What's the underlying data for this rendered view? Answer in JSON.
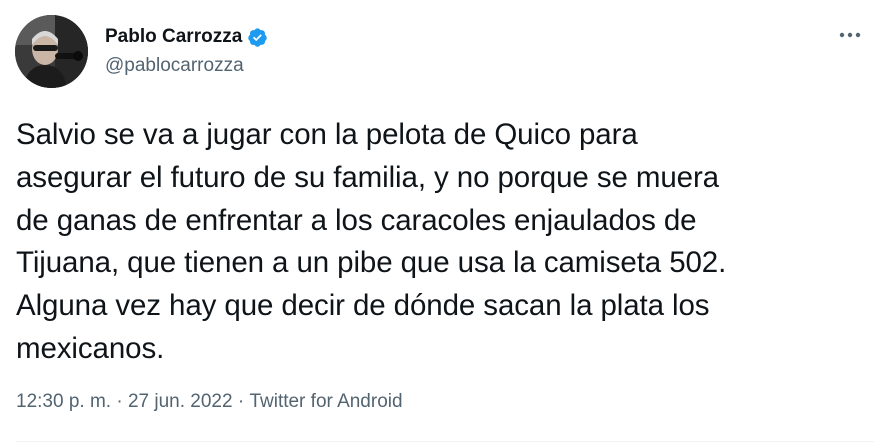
{
  "author": {
    "display_name": "Pablo Carrozza",
    "handle": "@pablocarrozza",
    "verified": true,
    "verified_color": "#1d9bf0"
  },
  "tweet": {
    "text": "Salvio se va a jugar con la pelota de Quico para\nasegurar el futuro de su familia, y no porque se muera\nde ganas de enfrentar a los caracoles enjaulados de\nTijuana, que tienen a un pibe que usa la camiseta 502.\nAlguna vez hay que decir de dónde sacan la plata los\nmexicanos."
  },
  "meta": {
    "time": "12:30 p. m.",
    "separator": " · ",
    "date": "27 jun. 2022",
    "source": "Twitter for Android"
  },
  "icons": {
    "more": "more-horizontal-icon",
    "verified": "verified-badge-icon"
  },
  "colors": {
    "text_primary": "#0f1419",
    "text_secondary": "#536471",
    "divider": "#eff3f4"
  }
}
